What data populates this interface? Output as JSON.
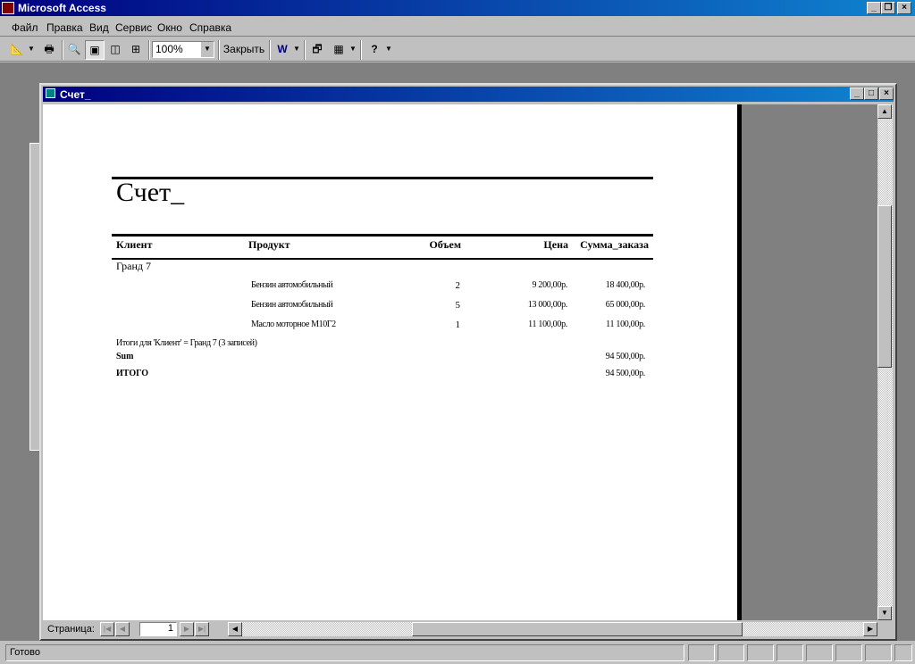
{
  "app": {
    "title": "Microsoft Access"
  },
  "menu": [
    "Файл",
    "Правка",
    "Вид",
    "Сервис",
    "Окно",
    "Справка"
  ],
  "toolbar": {
    "zoom": "100%",
    "close_label": "Закрыть"
  },
  "window": {
    "title": "Счет_"
  },
  "report": {
    "title": "Счет_",
    "headers": [
      "Клиент",
      "Продукт",
      "Объем",
      "Цена",
      "Сумма_заказа"
    ],
    "group": "Гранд 7",
    "rows": [
      {
        "product": "Бензин автомобильный",
        "qty": "2",
        "price": "9 200,00р.",
        "sum": "18 400,00р."
      },
      {
        "product": "Бензин автомобильный",
        "qty": "5",
        "price": "13 000,00р.",
        "sum": "65 000,00р."
      },
      {
        "product": "Масло моторное М10Г2",
        "qty": "1",
        "price": "11 100,00р.",
        "sum": "11 100,00р."
      }
    ],
    "group_summary": "Итоги для 'Клиент' =  Гранд 7 (3 записей)",
    "sum_label": "Sum",
    "sum_value": "94 500,00р.",
    "total_label": "ИТОГО",
    "total_value": "94 500,00р."
  },
  "nav": {
    "label": "Страница:",
    "page": "1"
  },
  "status": {
    "text": "Готово"
  }
}
